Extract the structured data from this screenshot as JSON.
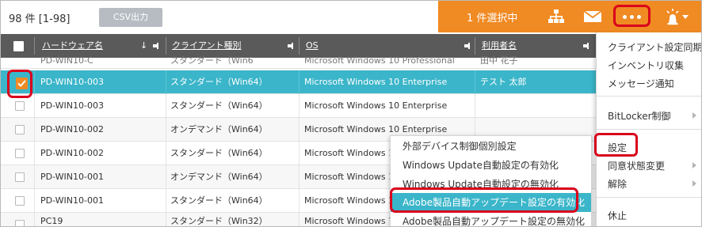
{
  "toolbar": {
    "count_label": "98 件  [1-98]",
    "csv_button": "CSV出力",
    "selected_label": "1 件選択中",
    "icons": [
      "hierarchy-icon",
      "mail-icon",
      "more-icon",
      "alert-light-icon"
    ],
    "accent_color": "#f08a23"
  },
  "table": {
    "columns": [
      {
        "label": "ハードウェア名",
        "sort": "↓"
      },
      {
        "label": "クライアント種別"
      },
      {
        "label": "OS"
      },
      {
        "label": "利用者名"
      }
    ],
    "partial_row": [
      "PD-WIN10-C",
      "スタンダード（Win6",
      "Microsoft Windows 10 Professional",
      "田中 花子"
    ],
    "rows": [
      {
        "checked": true,
        "selected": true,
        "hardware": "PD-WIN10-003",
        "type": "スタンダード（Win64）",
        "os": "Microsoft Windows 10 Enterprise",
        "user": "テスト 太郎"
      },
      {
        "checked": false,
        "selected": false,
        "hardware": "PD-WIN10-003",
        "type": "スタンダード（Win64）",
        "os": "Microsoft Windows 10 Enterprise",
        "user": ""
      },
      {
        "checked": false,
        "selected": false,
        "hardware": "PD-WIN10-002",
        "type": "オンデマンド（Win64）",
        "os": "Microsoft Windows 10 Enterprise",
        "user": ""
      },
      {
        "checked": false,
        "selected": false,
        "hardware": "PD-WIN10-002",
        "type": "スタンダード（Win64）",
        "os": "Microsoft Windows 10 Enterprise",
        "user": ""
      },
      {
        "checked": false,
        "selected": false,
        "hardware": "PD-WIN10-001",
        "type": "オンデマンド（Win64）",
        "os": "Microsoft Windows 10 Enterprise",
        "user": ""
      },
      {
        "checked": false,
        "selected": false,
        "hardware": "PD-WIN10-001",
        "type": "スタンダード（Win64）",
        "os": "Microsoft Windows 10 Enterprise",
        "user": ""
      },
      {
        "checked": false,
        "selected": false,
        "hardware": "PC19",
        "type": "スタンダード（Win32）",
        "os": "Microsoft Windows 7 Professional",
        "user": ""
      }
    ]
  },
  "menu": {
    "items": [
      {
        "label": "クライアント設定同期",
        "submenu": false
      },
      {
        "label": "インベントリ収集",
        "submenu": false
      },
      {
        "label": "メッセージ通知",
        "submenu": false
      },
      {
        "label": "BitLocker制御",
        "submenu": true
      },
      {
        "label": "設定",
        "submenu": false
      },
      {
        "label": "同意状態変更",
        "submenu": true
      },
      {
        "label": "解除",
        "submenu": true
      },
      {
        "label": "休止",
        "submenu": false
      }
    ]
  },
  "submenu": {
    "items": [
      {
        "label": "外部デバイス制御個別設定",
        "active": false
      },
      {
        "label": "Windows Update自動設定の有効化",
        "active": false
      },
      {
        "label": "Windows Update自動設定の無効化",
        "active": false
      },
      {
        "label": "Adobe製品自動アップデート設定の有効化",
        "active": true
      },
      {
        "label": "Adobe製品自動アップデート設定の無効化",
        "active": false
      }
    ]
  }
}
